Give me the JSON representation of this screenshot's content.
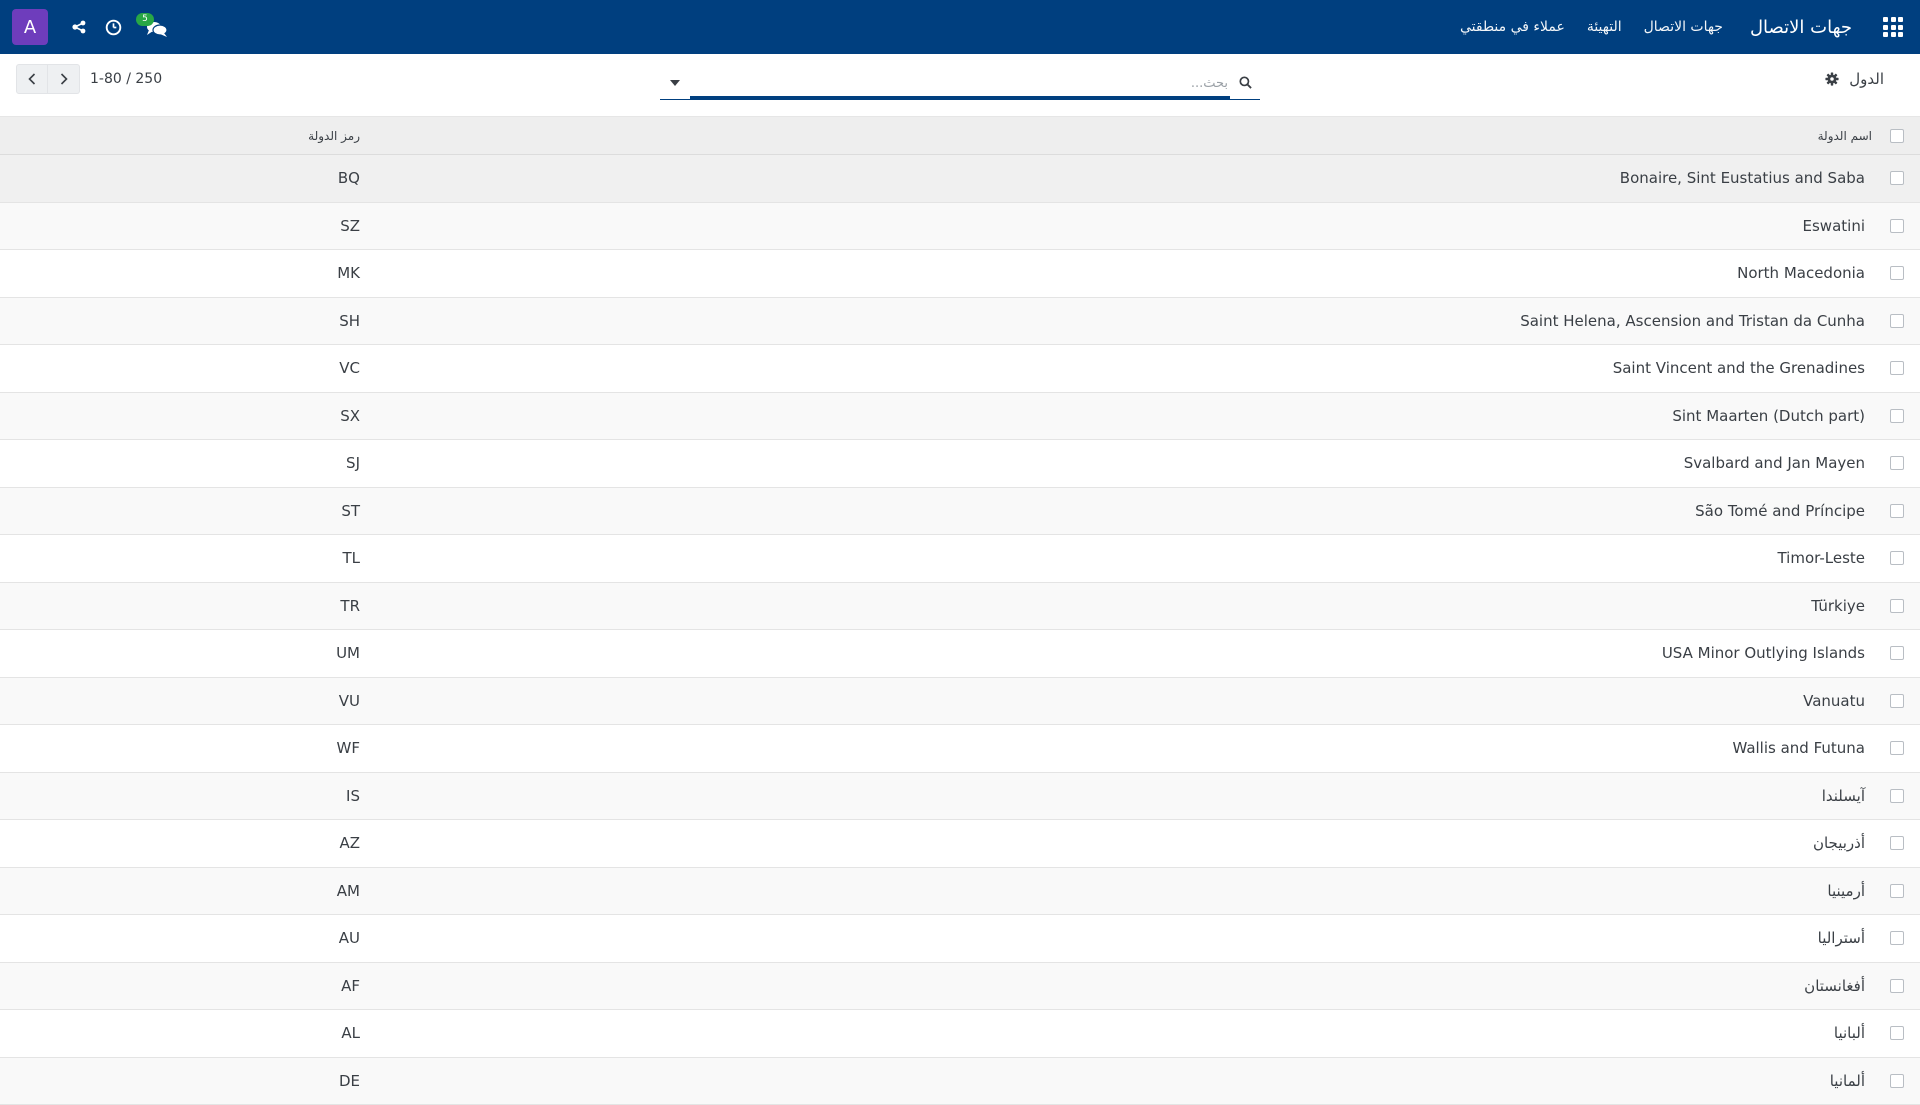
{
  "navbar": {
    "brand": "جهات الاتصال",
    "menu": [
      "جهات الاتصال",
      "التهيئة",
      "عملاء في منطقتي"
    ],
    "avatar_letter": "A",
    "messages_count": "5",
    "color": "#003f7f",
    "avatar_color": "#6e3dbc",
    "icons": [
      "apps-grid-icon",
      "chat-icon",
      "clock-icon",
      "share-icon"
    ]
  },
  "control_panel": {
    "breadcrumb": "الدول",
    "search_placeholder": "بحث...",
    "pager_value": "1-80 / 250"
  },
  "table": {
    "columns": {
      "name": "اسم الدولة",
      "code": "رمز الدولة"
    },
    "rows": [
      {
        "name": "Bonaire, Sint Eustatius and Saba",
        "code": "BQ"
      },
      {
        "name": "Eswatini",
        "code": "SZ"
      },
      {
        "name": "North Macedonia",
        "code": "MK"
      },
      {
        "name": "Saint Helena, Ascension and Tristan da Cunha",
        "code": "SH"
      },
      {
        "name": "Saint Vincent and the Grenadines",
        "code": "VC"
      },
      {
        "name": "Sint Maarten (Dutch part)",
        "code": "SX"
      },
      {
        "name": "Svalbard and Jan Mayen",
        "code": "SJ"
      },
      {
        "name": "São Tomé and Príncipe",
        "code": "ST"
      },
      {
        "name": "Timor-Leste",
        "code": "TL"
      },
      {
        "name": "Türkiye",
        "code": "TR"
      },
      {
        "name": "USA Minor Outlying Islands",
        "code": "UM"
      },
      {
        "name": "Vanuatu",
        "code": "VU"
      },
      {
        "name": "Wallis and Futuna",
        "code": "WF"
      },
      {
        "name": "آيسلندا",
        "code": "IS"
      },
      {
        "name": "أذربيجان",
        "code": "AZ"
      },
      {
        "name": "أرمينيا",
        "code": "AM"
      },
      {
        "name": "أستراليا",
        "code": "AU"
      },
      {
        "name": "أفغانستان",
        "code": "AF"
      },
      {
        "name": "ألبانيا",
        "code": "AL"
      },
      {
        "name": "ألمانيا",
        "code": "DE"
      }
    ]
  }
}
